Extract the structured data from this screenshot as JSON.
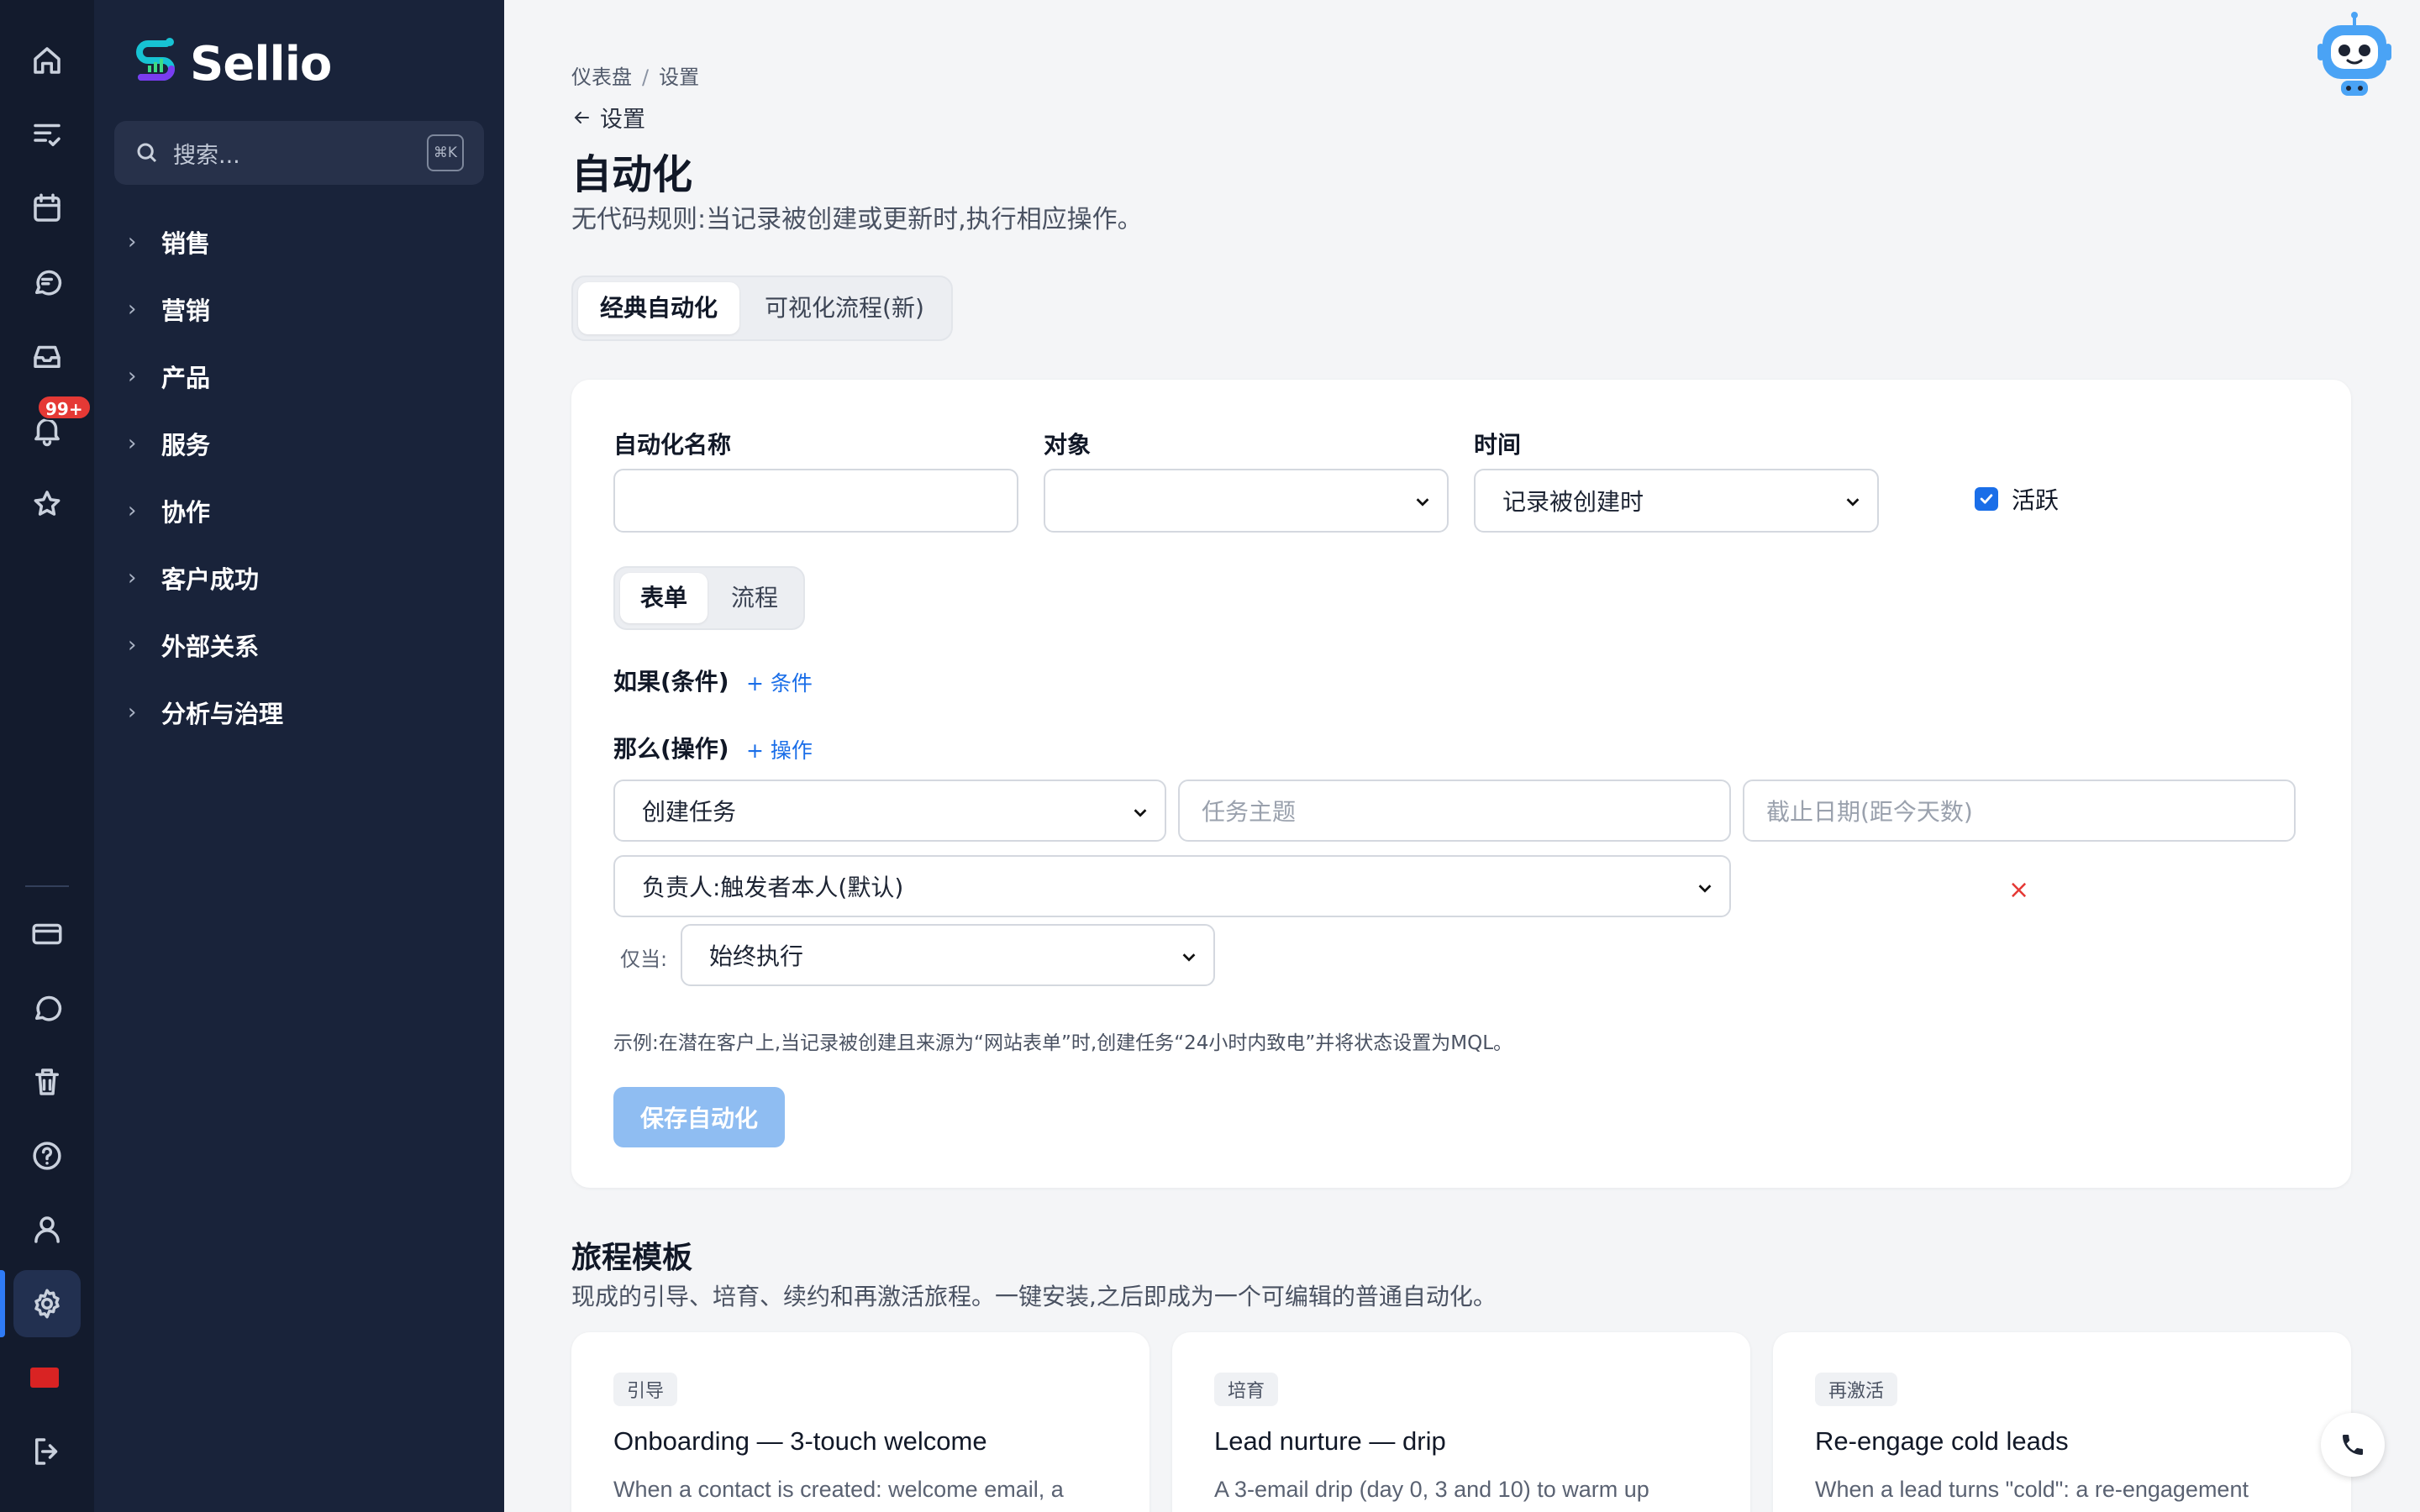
{
  "brand": {
    "name": "Sellio"
  },
  "rail": {
    "notification_badge": "99+",
    "icons": [
      "home-icon",
      "tasks-icon",
      "calendar-icon",
      "chat-icon",
      "inbox-icon",
      "bell-icon",
      "star-icon",
      "billing-icon",
      "comment-icon",
      "trash-icon",
      "help-icon",
      "user-icon",
      "gear-icon",
      "flag-icon",
      "logout-icon"
    ]
  },
  "sidebar": {
    "search_placeholder": "搜索...",
    "search_shortcut": "⌘K",
    "items": [
      {
        "label": "销售"
      },
      {
        "label": "营销"
      },
      {
        "label": "产品"
      },
      {
        "label": "服务"
      },
      {
        "label": "协作"
      },
      {
        "label": "客户成功"
      },
      {
        "label": "外部关系"
      },
      {
        "label": "分析与治理"
      }
    ]
  },
  "breadcrumb": {
    "first": "仪表盘",
    "separator": "/",
    "second": "设置"
  },
  "back_link": "设置",
  "page": {
    "title": "自动化",
    "subtitle": "无代码规则:当记录被创建或更新时,执行相应操作。"
  },
  "main_tabs": [
    {
      "label": "经典自动化",
      "active": true
    },
    {
      "label": "可视化流程(新)",
      "active": false
    }
  ],
  "form": {
    "name_label": "自动化名称",
    "name_value": "",
    "object_label": "对象",
    "object_value": "",
    "time_label": "时间",
    "time_value": "记录被创建时",
    "active_label": "活跃",
    "active_checked": true,
    "mode_tabs": [
      {
        "label": "表单",
        "active": true
      },
      {
        "label": "流程",
        "active": false
      }
    ],
    "if_label": "如果(条件)",
    "add_condition": "+ 条件",
    "then_label": "那么(操作)",
    "add_action": "+ 操作",
    "action_type": "创建任务",
    "task_subject_placeholder": "任务主题",
    "due_date_placeholder": "截止日期(距今天数)",
    "owner_value": "负责人:触发者本人(默认)",
    "delete_symbol": "×",
    "only_when_label": "仅当:",
    "only_when_value": "始终执行",
    "example": "示例:在潜在客户上,当记录被创建且来源为“网站表单”时,创建任务“24小时内致电”并将状态设置为MQL。",
    "save_label": "保存自动化"
  },
  "templates": {
    "title": "旅程模板",
    "subtitle": "现成的引导、培育、续约和再激活旅程。一键安装,之后即成为一个可编辑的普通自动化。",
    "cards": [
      {
        "tag": "引导",
        "title": "Onboarding — 3-touch welcome",
        "desc": "When a contact is created: welcome email, a"
      },
      {
        "tag": "培育",
        "title": "Lead nurture — drip",
        "desc": "A 3-email drip (day 0, 3 and 10) to warm up"
      },
      {
        "tag": "再激活",
        "title": "Re-engage cold leads",
        "desc": "When a lead turns \"cold\": a re-engagement"
      }
    ]
  },
  "colors": {
    "rail_bg": "#131b2d",
    "sidebar_bg": "#19233a",
    "accent": "#1a6ee8",
    "save_disabled": "#8fbdf2",
    "danger": "#e53935"
  }
}
